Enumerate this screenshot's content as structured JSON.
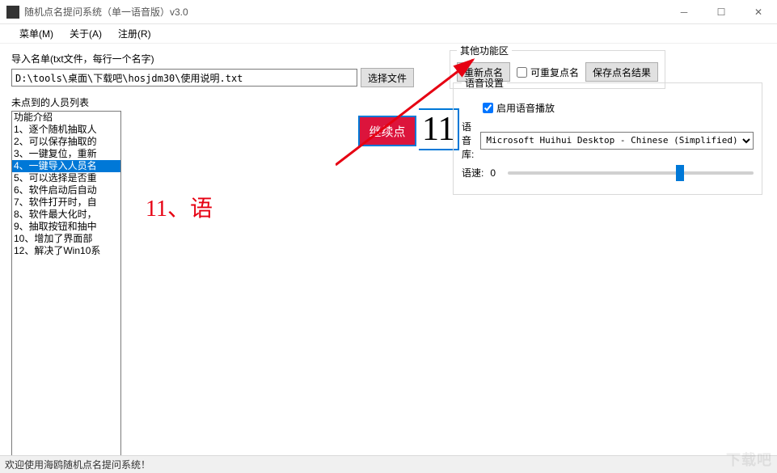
{
  "window": {
    "title": "随机点名提问系统（单一语音版）v3.0"
  },
  "menubar": {
    "items": [
      "菜单(M)",
      "关于(A)",
      "注册(R)"
    ]
  },
  "import": {
    "label": "导入名单(txt文件，每行一个名字)",
    "path": "D:\\tools\\桌面\\下载吧\\hosjdm30\\使用说明.txt",
    "choose_btn": "选择文件"
  },
  "other_area": {
    "legend": "其他功能区",
    "re_roll_btn": "重新点名",
    "repeat_chk": "可重复点名",
    "save_btn": "保存点名结果"
  },
  "list": {
    "label": "未点到的人员列表",
    "items": [
      "功能介绍",
      "1、逐个随机抽取人",
      "2、可以保存抽取的",
      "3、一键复位，重新",
      "4、一键导入人员名",
      "5、可以选择是否重",
      "6、软件启动后自动",
      "7、软件打开时，自",
      "8、软件最大化时，",
      "9、抽取按钮和抽中",
      "10、增加了界面部",
      "12、解决了Win10系"
    ],
    "selected_index": 4
  },
  "big_red": "11、语",
  "continue_btn": "继续点",
  "big_number": "11",
  "voice": {
    "legend": "语音设置",
    "enable_label": "启用语音播放",
    "lib_label": "语音库:",
    "lib_value": "Microsoft Huihui Desktop - Chinese (Simplified)",
    "speed_label": "语速:",
    "speed_value": "0",
    "speed_percent": 70
  },
  "statusbar": "欢迎使用海鸥随机点名提问系统！",
  "watermark": "下载吧"
}
